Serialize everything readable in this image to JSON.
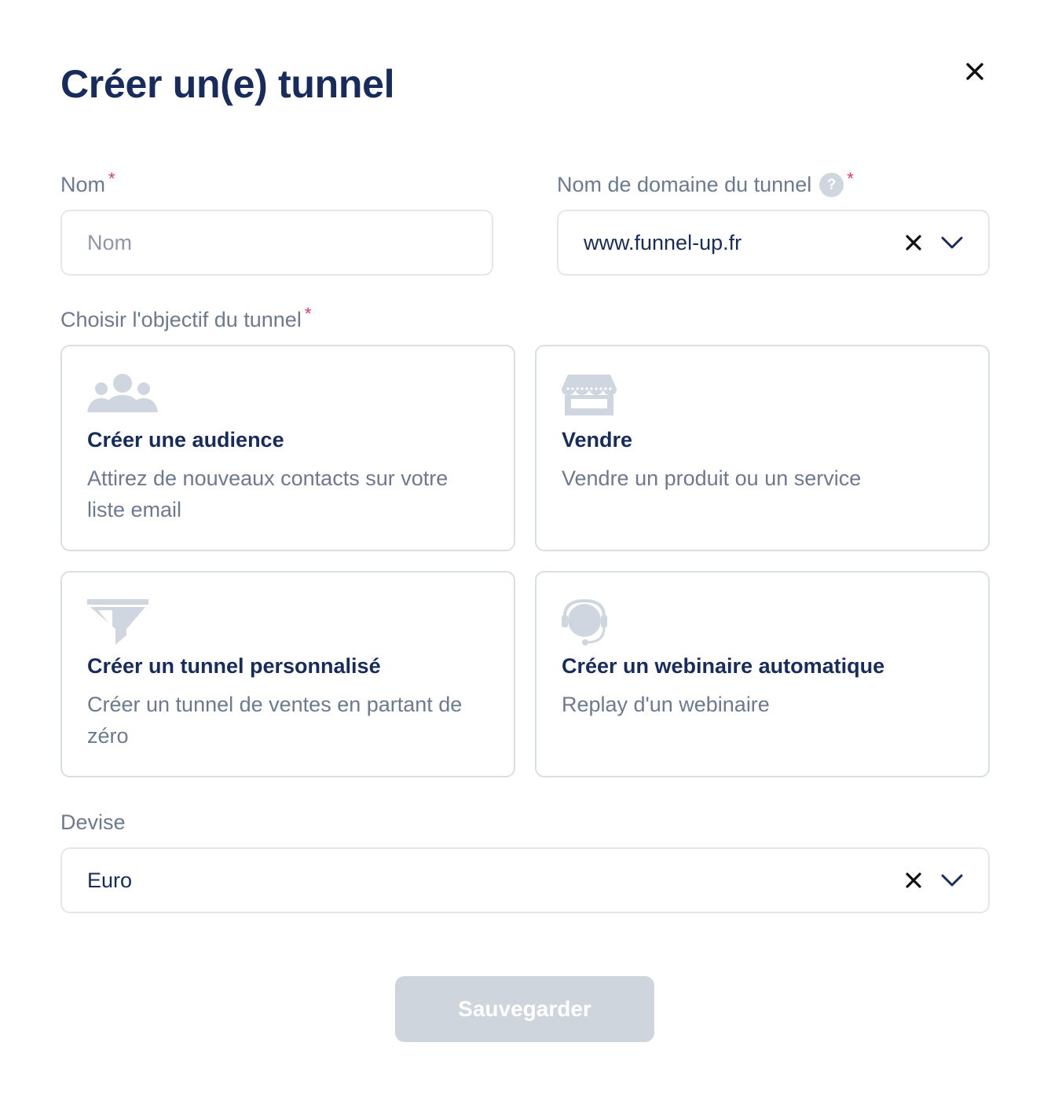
{
  "modal": {
    "title": "Créer un(e) tunnel",
    "close_icon": "close-icon"
  },
  "form": {
    "name": {
      "label": "Nom",
      "required_mark": "*",
      "placeholder": "Nom",
      "value": ""
    },
    "domain": {
      "label": "Nom de domaine du tunnel",
      "help_icon": "?",
      "required_mark": "*",
      "value": "www.funnel-up.fr"
    },
    "objective": {
      "label": "Choisir l'objectif du tunnel",
      "required_mark": "*",
      "options": [
        {
          "icon": "users-group-icon",
          "title": "Créer une audience",
          "description": "Attirez de nouveaux contacts sur votre liste email"
        },
        {
          "icon": "storefront-icon",
          "title": "Vendre",
          "description": "Vendre un produit ou un service"
        },
        {
          "icon": "funnel-icon",
          "title": "Créer un tunnel personnalisé",
          "description": "Créer un tunnel de ventes en partant de zéro"
        },
        {
          "icon": "headset-icon",
          "title": "Créer un webinaire automatique",
          "description": "Replay d'un webinaire"
        }
      ]
    },
    "currency": {
      "label": "Devise",
      "value": "Euro"
    }
  },
  "actions": {
    "save_label": "Sauvegarder"
  },
  "colors": {
    "title": "#172b5c",
    "label": "#6b7a8f",
    "required": "#e8365d",
    "border": "#e3e7ec",
    "icon": "#cfd6e0",
    "button_disabled": "#ced5dc"
  }
}
